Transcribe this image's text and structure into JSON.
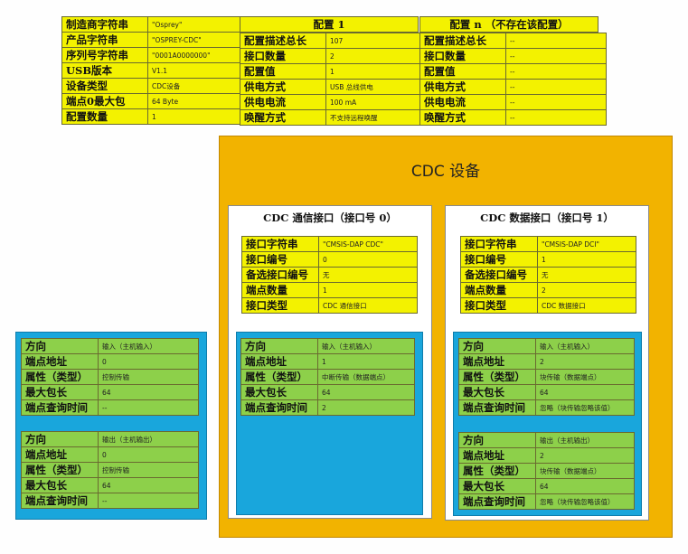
{
  "device": {
    "rows": [
      {
        "k": "制造商字符串",
        "v": "\"Osprey\""
      },
      {
        "k": "产品字符串",
        "v": "\"OSPREY-CDC\""
      },
      {
        "k": "序列号字符串",
        "v": "\"0001A0000000\""
      },
      {
        "k": "USB版本",
        "v": "V1.1"
      },
      {
        "k": "设备类型",
        "v": "CDC设备"
      },
      {
        "k": "端点0最大包",
        "v": "64 Byte"
      },
      {
        "k": "配置数量",
        "v": "1"
      }
    ]
  },
  "config1": {
    "header": "配置 1",
    "rows": [
      {
        "k": "配置描述总长",
        "v": "107"
      },
      {
        "k": "接口数量",
        "v": "2"
      },
      {
        "k": "配置值",
        "v": "1"
      },
      {
        "k": "供电方式",
        "v": "USB 总线供电"
      },
      {
        "k": "供电电流",
        "v": "100 mA"
      },
      {
        "k": "唤醒方式",
        "v": "不支持远程唤醒"
      }
    ]
  },
  "configN": {
    "header": "配置 n （不存在该配置）",
    "rows": [
      {
        "k": "配置描述总长",
        "v": "--"
      },
      {
        "k": "接口数量",
        "v": "--"
      },
      {
        "k": "配置值",
        "v": "--"
      },
      {
        "k": "供电方式",
        "v": "--"
      },
      {
        "k": "供电电流",
        "v": "--"
      },
      {
        "k": "唤醒方式",
        "v": "--"
      }
    ]
  },
  "cdc": {
    "title": "CDC 设备",
    "comm": {
      "title": "CDC 通信接口（接口号 0）",
      "rows": [
        {
          "k": "接口字符串",
          "v": "\"CMSIS-DAP CDC\""
        },
        {
          "k": "接口编号",
          "v": "0"
        },
        {
          "k": "备选接口编号",
          "v": "无"
        },
        {
          "k": "端点数量",
          "v": "1"
        },
        {
          "k": "接口类型",
          "v": "CDC 通信接口"
        }
      ],
      "endpoint": [
        {
          "k": "方向",
          "v": "输入（主机输入）"
        },
        {
          "k": "端点地址",
          "v": "1"
        },
        {
          "k": "属性（类型）",
          "v": "中断传输（数据端点）"
        },
        {
          "k": "最大包长",
          "v": "64"
        },
        {
          "k": "端点查询时间",
          "v": "2"
        }
      ]
    },
    "data": {
      "title": "CDC 数据接口（接口号 1）",
      "rows": [
        {
          "k": "接口字符串",
          "v": "\"CMSIS-DAP DCI\""
        },
        {
          "k": "接口编号",
          "v": "1"
        },
        {
          "k": "备选接口编号",
          "v": "无"
        },
        {
          "k": "端点数量",
          "v": "2"
        },
        {
          "k": "接口类型",
          "v": "CDC 数据接口"
        }
      ],
      "ep_in": [
        {
          "k": "方向",
          "v": "输入（主机输入）"
        },
        {
          "k": "端点地址",
          "v": "2"
        },
        {
          "k": "属性（类型）",
          "v": "块传输（数据端点）"
        },
        {
          "k": "最大包长",
          "v": "64"
        },
        {
          "k": "端点查询时间",
          "v": "忽略（块传输忽略该值）"
        }
      ],
      "ep_out": [
        {
          "k": "方向",
          "v": "输出（主机输出）"
        },
        {
          "k": "端点地址",
          "v": "2"
        },
        {
          "k": "属性（类型）",
          "v": "块传输（数据端点）"
        },
        {
          "k": "最大包长",
          "v": "64"
        },
        {
          "k": "端点查询时间",
          "v": "忽略（块传输忽略该值）"
        }
      ]
    }
  },
  "ep0": {
    "in": [
      {
        "k": "方向",
        "v": "输入（主机输入）"
      },
      {
        "k": "端点地址",
        "v": "0"
      },
      {
        "k": "属性（类型）",
        "v": "控制传输"
      },
      {
        "k": "最大包长",
        "v": "64"
      },
      {
        "k": "端点查询时间",
        "v": "--"
      }
    ],
    "out": [
      {
        "k": "方向",
        "v": "输出（主机输出）"
      },
      {
        "k": "端点地址",
        "v": "0"
      },
      {
        "k": "属性（类型）",
        "v": "控制传输"
      },
      {
        "k": "最大包长",
        "v": "64"
      },
      {
        "k": "端点查询时间",
        "v": "--"
      }
    ]
  }
}
